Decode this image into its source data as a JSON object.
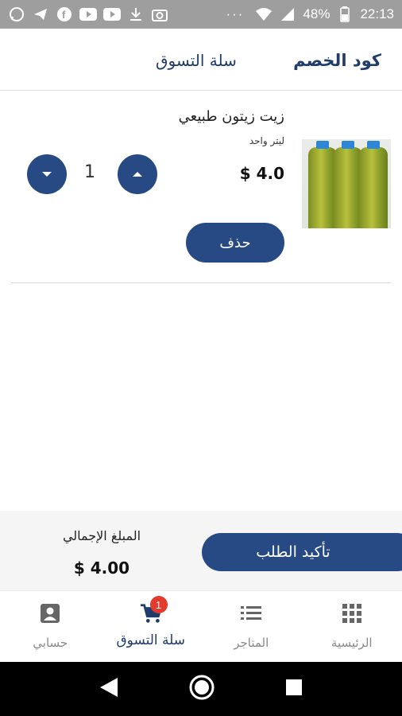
{
  "status_bar": {
    "battery": "48%",
    "time": "22:13",
    "overflow": "···",
    "icons": [
      "whatsapp-icon",
      "telegram-icon",
      "facebook-icon",
      "youtube-icon",
      "youtube-icon",
      "download-icon",
      "camera-icon",
      "wifi-icon",
      "signal-icon",
      "battery-icon"
    ]
  },
  "header": {
    "discount_code": "كود الخصم",
    "title": "سلة التسوق"
  },
  "cart_items": [
    {
      "name": "زيت زيتون طبيعي",
      "unit": "ليتر واحد",
      "price": "$ 4.0",
      "quantity": "1",
      "delete_label": "حذف"
    }
  ],
  "summary": {
    "confirm_label": "تأكيد الطلب",
    "total_label": "المبلغ الإجمالي",
    "total_value": "$ 4.00"
  },
  "bottom_nav": {
    "items": [
      {
        "label": "حسابي",
        "icon": "account-icon"
      },
      {
        "label": "سلة التسوق",
        "icon": "cart-icon",
        "badge": "1",
        "active": true
      },
      {
        "label": "المتاجر",
        "icon": "list-icon"
      },
      {
        "label": "الرئيسية",
        "icon": "grid-icon"
      }
    ]
  },
  "colors": {
    "primary": "#274a84",
    "title": "#1f3c6b",
    "badge": "#e33c2f",
    "status_bar": "#9e9e9e"
  }
}
